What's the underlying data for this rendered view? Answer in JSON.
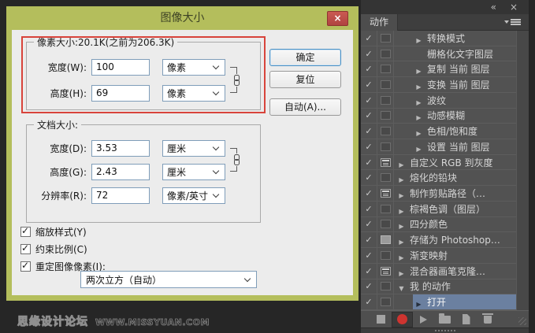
{
  "dialog": {
    "title": "图像大小",
    "close_glyph": "×",
    "pixel_group": {
      "legend": "像素大小:20.1K(之前为206.3K)",
      "fields": [
        {
          "label": "宽度(W):",
          "value": "100",
          "unit": "像素"
        },
        {
          "label": "高度(H):",
          "value": "69",
          "unit": "像素"
        }
      ]
    },
    "document_group": {
      "legend": "文档大小:",
      "fields": [
        {
          "label": "宽度(D):",
          "value": "3.53",
          "unit": "厘米"
        },
        {
          "label": "高度(G):",
          "value": "2.43",
          "unit": "厘米"
        },
        {
          "label": "分辨率(R):",
          "value": "72",
          "unit": "像素/英寸"
        }
      ]
    },
    "options": [
      {
        "label": "缩放样式(Y)",
        "checked": true
      },
      {
        "label": "约束比例(C)",
        "checked": true
      },
      {
        "label": "重定图像像素(I):",
        "checked": true
      }
    ],
    "resample_value": "两次立方（自动）",
    "buttons": {
      "ok": "确定",
      "reset": "复位",
      "auto": "自动(A)..."
    }
  },
  "panel": {
    "tab_label": "动作",
    "rows": [
      {
        "label": "转换模式",
        "checked": true,
        "toggle": "empty",
        "expand": "collapsed",
        "level": "step"
      },
      {
        "label": "栅格化文字图层",
        "checked": true,
        "toggle": "empty",
        "expand": "none",
        "level": "step"
      },
      {
        "label": "复制 当前 图层",
        "checked": true,
        "toggle": "empty",
        "expand": "collapsed",
        "level": "step"
      },
      {
        "label": "变换 当前 图层",
        "checked": true,
        "toggle": "empty",
        "expand": "collapsed",
        "level": "step"
      },
      {
        "label": "波纹",
        "checked": true,
        "toggle": "empty",
        "expand": "collapsed",
        "level": "step"
      },
      {
        "label": "动感模糊",
        "checked": true,
        "toggle": "empty",
        "expand": "collapsed",
        "level": "step"
      },
      {
        "label": "色相/饱和度",
        "checked": true,
        "toggle": "empty",
        "expand": "collapsed",
        "level": "step"
      },
      {
        "label": "设置 当前 图层",
        "checked": true,
        "toggle": "empty",
        "expand": "collapsed",
        "level": "step"
      },
      {
        "label": "自定义 RGB 到灰度",
        "checked": true,
        "toggle": "dialog",
        "expand": "collapsed",
        "level": "action"
      },
      {
        "label": "熔化的铅块",
        "checked": true,
        "toggle": "empty",
        "expand": "collapsed",
        "level": "action"
      },
      {
        "label": "制作剪贴路径（…",
        "checked": true,
        "toggle": "dialog",
        "expand": "collapsed",
        "level": "action"
      },
      {
        "label": "棕褐色调（图层）",
        "checked": true,
        "toggle": "empty",
        "expand": "collapsed",
        "level": "action"
      },
      {
        "label": "四分颜色",
        "checked": true,
        "toggle": "empty",
        "expand": "collapsed",
        "level": "action"
      },
      {
        "label": "存储为 Photoshop…",
        "checked": true,
        "toggle": "dialog-filled",
        "expand": "collapsed",
        "level": "action"
      },
      {
        "label": "渐变映射",
        "checked": true,
        "toggle": "empty",
        "expand": "collapsed",
        "level": "action"
      },
      {
        "label": "混合器画笔克隆…",
        "checked": true,
        "toggle": "dialog",
        "expand": "collapsed",
        "level": "action"
      },
      {
        "label": "我 的动作",
        "checked": true,
        "toggle": "empty",
        "expand": "expanded",
        "level": "action"
      },
      {
        "label": "打开",
        "checked": true,
        "toggle": "empty",
        "expand": "collapsed",
        "level": "step",
        "selected": true
      }
    ],
    "toolbar": [
      "stop",
      "record",
      "play",
      "new-set",
      "new-action",
      "delete"
    ]
  },
  "watermark": {
    "site_name": "思缘设计论坛",
    "site_url": "www.missyuan.com"
  },
  "colors": {
    "title_bar_green": "#b4be5c",
    "close_button_red": "#bf4b44",
    "annotation_red": "#d8443b",
    "dialog_bg": "#ececec",
    "panel_bg": "#525252",
    "selection_blue": "#6b80a0",
    "record_red": "#ce3430"
  }
}
